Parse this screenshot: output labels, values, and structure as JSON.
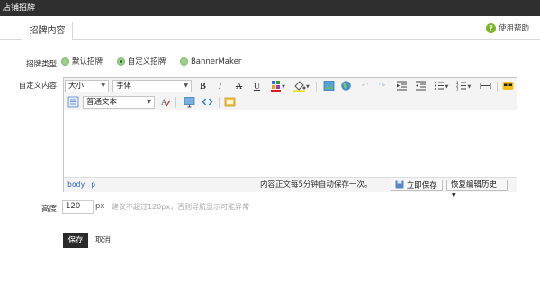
{
  "window": {
    "title": "店铺招牌"
  },
  "tabs": [
    {
      "label": "招牌内容"
    }
  ],
  "help": {
    "label": "使用帮助"
  },
  "form": {
    "type_label": "招牌类型:",
    "types": [
      {
        "label": "默认招牌",
        "selected": false
      },
      {
        "label": "自定义招牌",
        "selected": true
      },
      {
        "label": "BannerMaker",
        "selected": false
      }
    ],
    "content_label": "自定义内容:",
    "height_label": "高度:",
    "height_value": "120",
    "height_unit": "px",
    "height_hint": "建议不超过120px，否则导航显示可能异常"
  },
  "editor": {
    "font_size_select": "大小",
    "font_family_select": "字体",
    "paragraph_select": "普通文本",
    "path": [
      "body",
      "p"
    ],
    "autosave_text": "内容正文每5分钟自动保存一次。",
    "save_now_label": "立即保存",
    "restore_label": "恢复编辑历史"
  },
  "actions": {
    "save_label": "保存",
    "cancel_label": "取消"
  },
  "colors": {
    "titlebar": "#2f2f2f",
    "radio": "#9ed08c",
    "path_link": "#2d64b3",
    "save_button": "#2a2a2a"
  }
}
